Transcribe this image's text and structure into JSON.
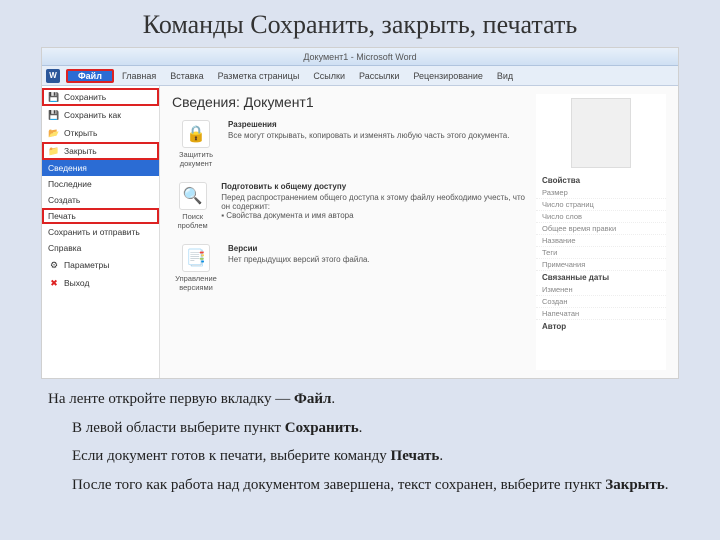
{
  "slide_title": "Команды Сохранить, закрыть, печатать",
  "window_title": "Документ1 - Microsoft Word",
  "tabs": {
    "file": "Файл",
    "home": "Главная",
    "insert": "Вставка",
    "layout": "Разметка страницы",
    "refs": "Ссылки",
    "mail": "Рассылки",
    "review": "Рецензирование",
    "view": "Вид"
  },
  "menu": {
    "save": "Сохранить",
    "save_as": "Сохранить как",
    "open": "Открыть",
    "close": "Закрыть",
    "info": "Сведения",
    "recent": "Последние",
    "new": "Создать",
    "print": "Печать",
    "share": "Сохранить и отправить",
    "help": "Справка",
    "options": "Параметры",
    "exit": "Выход"
  },
  "info": {
    "heading": "Сведения: Документ1",
    "perm_title": "Разрешения",
    "perm_text": "Все могут открывать, копировать и изменять любую часть этого документа.",
    "protect_btn": "Защитить документ",
    "share_title": "Подготовить к общему доступу",
    "share_text": "Перед распространением общего доступа к этому файлу необходимо учесть, что он содержит:",
    "share_bullet": "Свойства документа и имя автора",
    "check_btn": "Поиск проблем",
    "versions_title": "Версии",
    "versions_text": "Нет предыдущих версий этого файла.",
    "versions_btn": "Управление версиями"
  },
  "props": {
    "head": "Свойства",
    "rows": [
      "Размер",
      "Число страниц",
      "Число слов",
      "Общее время правки",
      "Название",
      "Теги",
      "Примечания"
    ],
    "head2": "Связанные даты",
    "rows2": [
      "Изменен",
      "Создан",
      "Напечатан"
    ],
    "head3": "Автор"
  },
  "body": {
    "p1a": "На ленте откройте первую вкладку — ",
    "p1b": "Файл",
    "p2a": "В левой области выберите пункт ",
    "p2b": "Сохранить",
    "p3a": "Если документ готов к печати, выберите команду ",
    "p3b": "Печать",
    "p4a": "После того как работа над документом завершена, текст сохранен, выберите пункт ",
    "p4b": "Закрыть"
  }
}
